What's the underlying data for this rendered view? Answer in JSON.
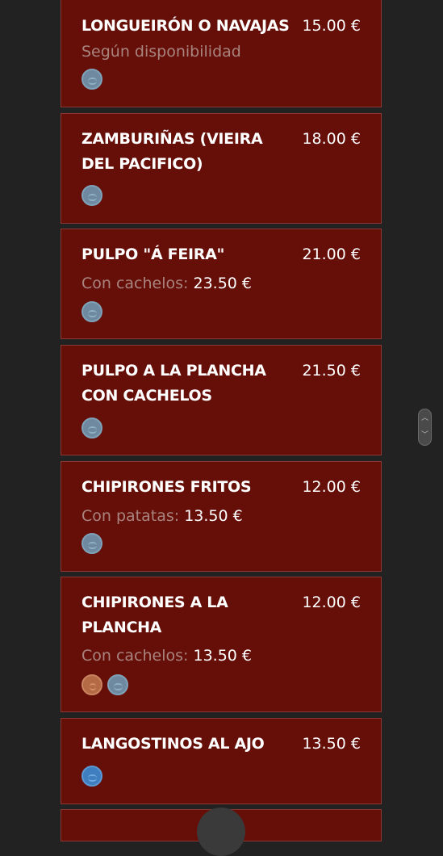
{
  "items": [
    {
      "name": "LONGUEIRÓN O NAVAJAS",
      "price": "15.00 €",
      "note": "Según disponibilidad",
      "note_price": "",
      "tags": [
        "seafood-icon"
      ]
    },
    {
      "name": "ZAMBURIÑAS (VIEIRA DEL PACIFICO)",
      "price": "18.00 €",
      "note": "",
      "note_price": "",
      "tags": [
        "seafood-icon"
      ]
    },
    {
      "name": "PULPO \"Á FEIRA\"",
      "price": "21.00 €",
      "note": "Con cachelos:",
      "note_price": "23.50 €",
      "tags": [
        "seafood-icon"
      ]
    },
    {
      "name": "PULPO A LA PLANCHA CON CACHELOS",
      "price": "21.50 €",
      "note": "",
      "note_price": "",
      "tags": [
        "seafood-icon"
      ]
    },
    {
      "name": "CHIPIRONES FRITOS",
      "price": "12.00 €",
      "note": "Con patatas:",
      "note_price": "13.50 €",
      "tags": [
        "seafood-icon"
      ]
    },
    {
      "name": "CHIPIRONES A LA PLANCHA",
      "price": "12.00 €",
      "note": "Con cachelos:",
      "note_price": "13.50 €",
      "tags": [
        "gluten-icon",
        "seafood-icon"
      ]
    },
    {
      "name": "LANGOSTINOS AL AJO",
      "price": "13.50 €",
      "note": "",
      "note_price": "",
      "tags": [
        "crustacean-icon"
      ]
    }
  ],
  "colors": {
    "background": "#222222",
    "card": "#660f09",
    "card_border": "#8a3a33",
    "note_text": "#a9847f"
  }
}
